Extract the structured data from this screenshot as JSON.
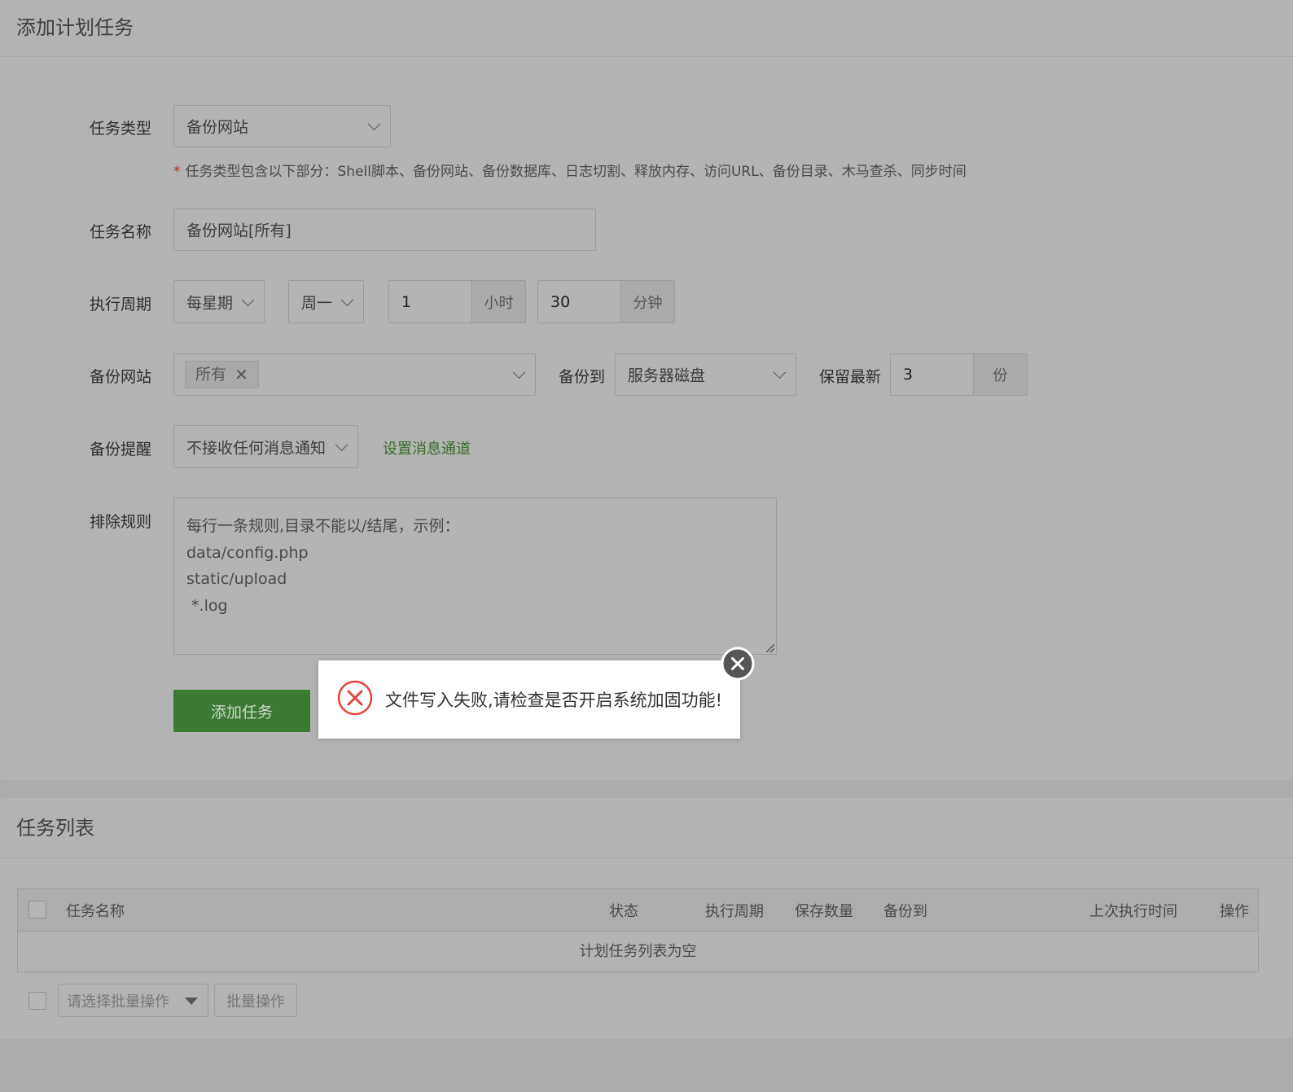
{
  "add_panel": {
    "title": "添加计划任务",
    "task_type": {
      "label": "任务类型",
      "value": "备份网站"
    },
    "hint": {
      "star": "*",
      "text": "任务类型包含以下部分：Shell脚本、备份网站、备份数据库、日志切割、释放内存、访问URL、备份目录、木马查杀、同步时间"
    },
    "task_name": {
      "label": "任务名称",
      "value": "备份网站[所有]"
    },
    "cycle": {
      "label": "执行周期",
      "period": "每星期",
      "weekday": "周一",
      "hour_value": "1",
      "hour_unit": "小时",
      "minute_value": "30",
      "minute_unit": "分钟"
    },
    "backup_site": {
      "label": "备份网站",
      "tag": "所有",
      "tag_remove": "✕"
    },
    "backup_to": {
      "label": "备份到",
      "value": "服务器磁盘"
    },
    "keep_latest": {
      "label": "保留最新",
      "value": "3",
      "unit": "份"
    },
    "notify": {
      "label": "备份提醒",
      "value": "不接收任何消息通知",
      "link": "设置消息通道"
    },
    "exclude": {
      "label": "排除规则",
      "placeholder": "每行一条规则,目录不能以/结尾，示例：\ndata/config.php\nstatic/upload\n *.log"
    },
    "submit": "添加任务"
  },
  "list_panel": {
    "title": "任务列表",
    "columns": [
      "任务名称",
      "状态",
      "执行周期",
      "保存数量",
      "备份到",
      "上次执行时间",
      "操作"
    ],
    "empty_text": "计划任务列表为空",
    "batch_select_placeholder": "请选择批量操作",
    "batch_button": "批量操作"
  },
  "dialog": {
    "message": "文件写入失败,请检查是否开启系统加固功能!",
    "icon": "error-circle-icon",
    "close_icon": "close-icon"
  },
  "colors": {
    "accent_green": "#3b7a32",
    "error_red": "#e0453b",
    "overlay": "#b3b3b3"
  }
}
